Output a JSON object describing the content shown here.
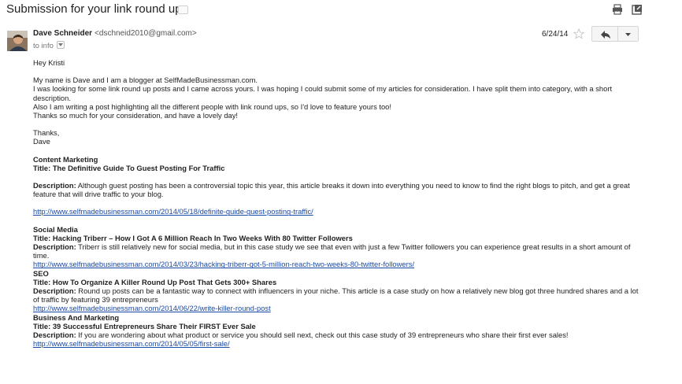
{
  "header": {
    "subject": "Submission for your link round up",
    "label_icon": "label-icon",
    "print_icon": "print-icon",
    "new_window_icon": "new-window-icon"
  },
  "message": {
    "sender_name": "Dave Schneider",
    "sender_email": "<dschneid2010@gmail.com>",
    "recipient": "to info",
    "date": "6/24/14",
    "star_icon": "star-icon",
    "reply_icon": "reply-icon",
    "more_icon": "chevron-down-icon"
  },
  "body": {
    "greeting": "Hey Kristi",
    "intro": [
      "My name is Dave and I am a blogger at SelfMadeBusinessman.com.",
      "I was looking for some link round up posts and I came across yours. I was hoping I could submit some of my articles for consideration. I have split them into category, with a short description.",
      "Also I am writing a post highlighting all the different people with link round ups, so I'd love to feature yours too!",
      "Thanks so much for your consideration, and have a lovely day!"
    ],
    "signoff": "Thanks,",
    "signature": "Dave",
    "articles": [
      {
        "category": "Content Marketing",
        "title": "Title: The Definitive Guide To Guest Posting For Traffic",
        "desc_label": "Description:",
        "desc": " Although guest posting has been a controversial topic this year, this article breaks it down into everything you need to know to find the right blogs to pitch, and get a great feature that will drive traffic to your blog.",
        "url": "http://www.selfmadebusinessman.com/2014/05/18/definite-guide-guest-posting-traffic/"
      },
      {
        "category": "Social Media",
        "title": "Title: Hacking Triberr – How I Got A 6 Million Reach In Two Weeks With 80 Twitter Followers",
        "desc_label": "Description:",
        "desc": " Triberr is still relatively new for social media, but in this case study we see that even with just a few Twitter followers you can experience great results in a short amount of time.",
        "url": "http://www.selfmadebusinessman.com/2014/03/23/hacking-triberr-got-5-million-reach-two-weeks-80-twitter-followers/"
      },
      {
        "category": "SEO",
        "title": "Title: How To Organize A Killer Round Up Post That Gets 300+ Shares",
        "desc_label": "Description:",
        "desc": " Round up posts can be a fantastic way to connect with influencers in your niche. This article is a case study on how a relatively new blog got three hundred shares and a lot of traffic by featuring 39 entrepreneurs",
        "url": "http://www.selfmadebusinessman.com/2014/06/22/write-killer-round-post"
      },
      {
        "category": "Business And Marketing",
        "title": "Title: 39 Successful Entrepreneurs Share Their FIRST Ever Sale",
        "desc_label": "Description:",
        "desc": " If you are wondering about what product or service you should sell next, check out this case study of 39 entrepreneurs who share their first ever sales!",
        "url": "http://www.selfmadebusinessman.com/2014/05/05/first-sale/"
      }
    ]
  }
}
